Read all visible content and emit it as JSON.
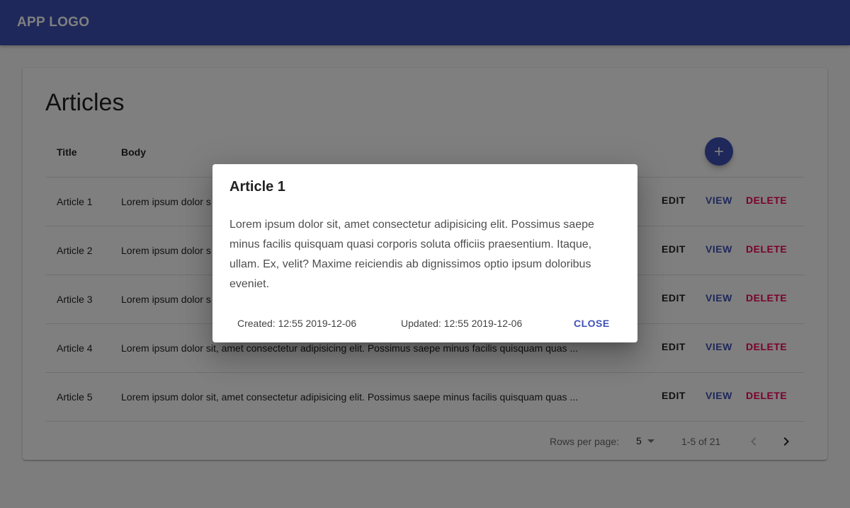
{
  "app": {
    "logo": "APP LOGO"
  },
  "page": {
    "title": "Articles"
  },
  "table": {
    "headers": {
      "title": "Title",
      "body": "Body"
    },
    "rows": [
      {
        "title": "Article 1",
        "body": "Lorem ipsum dolor s"
      },
      {
        "title": "Article 2",
        "body": "Lorem ipsum dolor s"
      },
      {
        "title": "Article 3",
        "body": "Lorem ipsum dolor s"
      },
      {
        "title": "Article 4",
        "body": "Lorem ipsum dolor sit, amet consectetur adipisicing elit. Possimus saepe minus facilis quisquam quas ..."
      },
      {
        "title": "Article 5",
        "body": "Lorem ipsum dolor sit, amet consectetur adipisicing elit. Possimus saepe minus facilis quisquam quas ..."
      }
    ],
    "actions": {
      "edit": "EDIT",
      "view": "VIEW",
      "delete": "DELETE"
    }
  },
  "pagination": {
    "rows_per_page_label": "Rows per page:",
    "rows_per_page_value": "5",
    "range": "1-5 of 21"
  },
  "dialog": {
    "title": "Article 1",
    "body": "Lorem ipsum dolor sit, amet consectetur adipisicing elit. Possimus saepe minus facilis quisquam quasi corporis soluta officiis praesentium. Itaque, ullam. Ex, velit? Maxime reiciendis ab dignissimos optio ipsum doloribus eveniet.",
    "created": "Created: 12:55 2019-12-06",
    "updated": "Updated: 12:55 2019-12-06",
    "close_label": "CLOSE"
  },
  "colors": {
    "primary": "#3f51b5",
    "secondary": "#f50057"
  },
  "icons": {
    "fab": "plus-icon",
    "prev": "chevron-left-icon",
    "next": "chevron-right-icon",
    "select": "dropdown-arrow-icon"
  }
}
